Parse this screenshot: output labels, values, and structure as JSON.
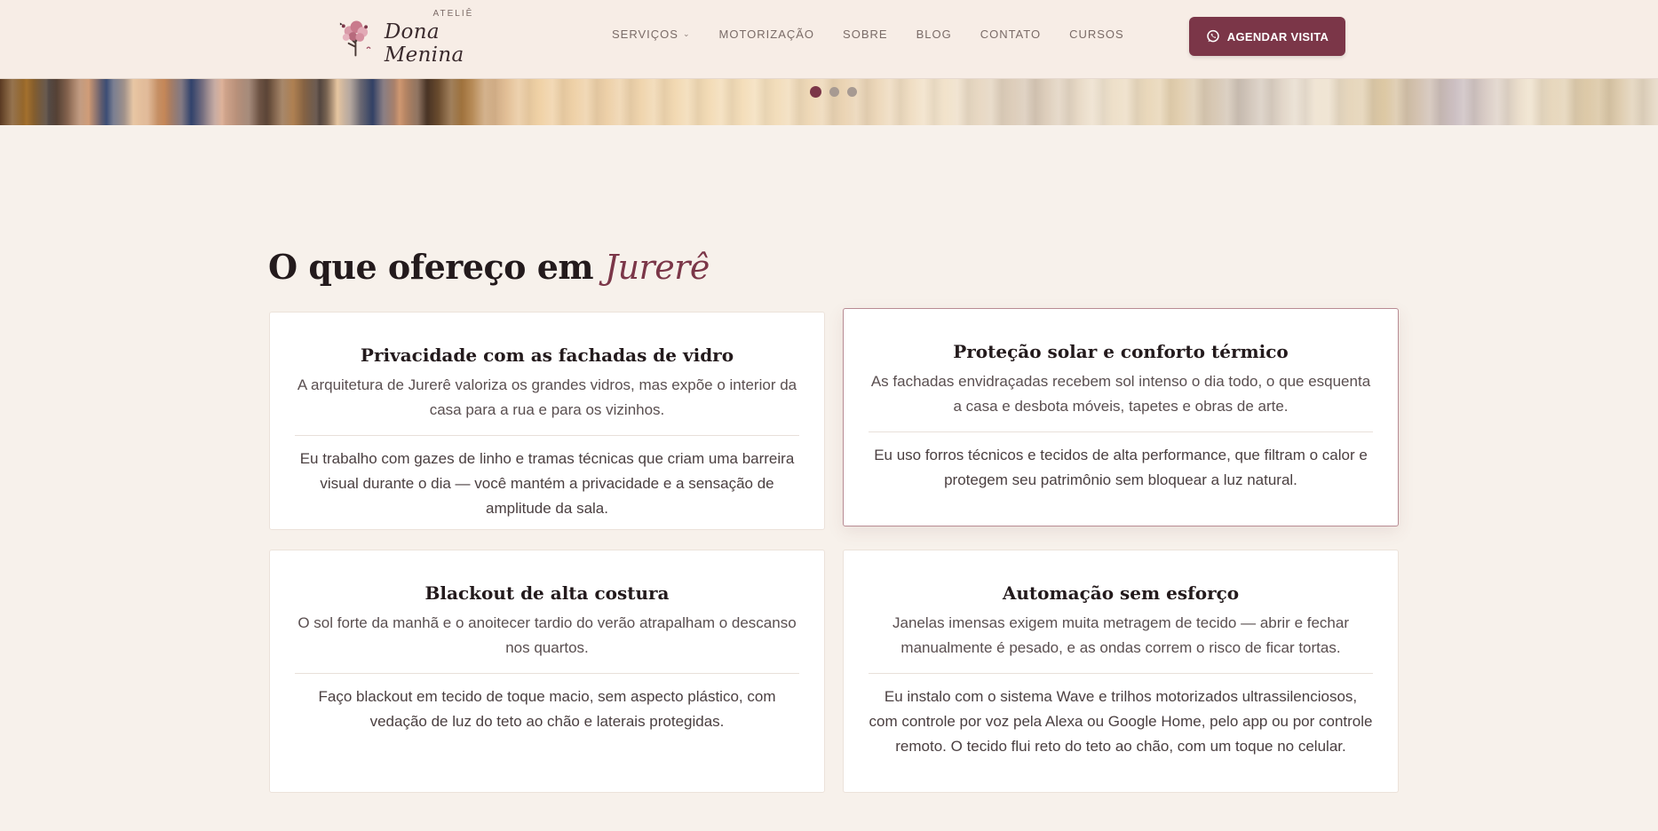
{
  "brand": {
    "small": "ATELIÊ",
    "name": "Dona Menina"
  },
  "nav": {
    "items": [
      {
        "label": "SERVIÇOS",
        "has_dropdown": true
      },
      {
        "label": "MOTORIZAÇÃO"
      },
      {
        "label": "SOBRE"
      },
      {
        "label": "BLOG"
      },
      {
        "label": "CONTATO"
      },
      {
        "label": "CURSOS"
      }
    ]
  },
  "cta": {
    "label": "AGENDAR VISITA",
    "icon": "whatsapp-icon",
    "color": "#7b3648"
  },
  "carousel": {
    "slides": 3,
    "active_index": 0
  },
  "section": {
    "title_prefix": "O que ofereço em ",
    "title_accent": "Jurerê",
    "accent_color": "#7b3648"
  },
  "cards": [
    {
      "title": "Privacidade com as fachadas de vidro",
      "lead": "A arquitetura de Jurerê valoriza os grandes vidros, mas expõe o interior da casa para a rua e para os vizinhos.",
      "body": "Eu trabalho com gazes de linho e tramas técnicas que criam uma barreira visual durante o dia — você mantém a privacidade e a sensação de amplitude da sala."
    },
    {
      "title": "Proteção solar e conforto térmico",
      "lead": "As fachadas envidraçadas recebem sol intenso o dia todo, o que esquenta a casa e desbota móveis, tapetes e obras de arte.",
      "body": "Eu uso forros técnicos e tecidos de alta performance, que filtram o calor e protegem seu patrimônio sem bloquear a luz natural."
    },
    {
      "title": "Blackout de alta costura",
      "lead": "O sol forte da manhã e o anoitecer tardio do verão atrapalham o descanso nos quartos.",
      "body": "Faço blackout em tecido de toque macio, sem aspecto plástico, com vedação de luz do teto ao chão e laterais protegidas."
    },
    {
      "title": "Automação sem esforço",
      "lead": "Janelas imensas exigem muita metragem de tecido — abrir e fechar manualmente é pesado, e as ondas correm o risco de ficar tortas.",
      "body": "Eu instalo com o sistema Wave e trilhos motorizados ultrassilenciosos, com controle por voz pela Alexa ou Google Home, pelo app ou por controle remoto. O tecido flui reto do teto ao chão, com um toque no celular."
    }
  ]
}
